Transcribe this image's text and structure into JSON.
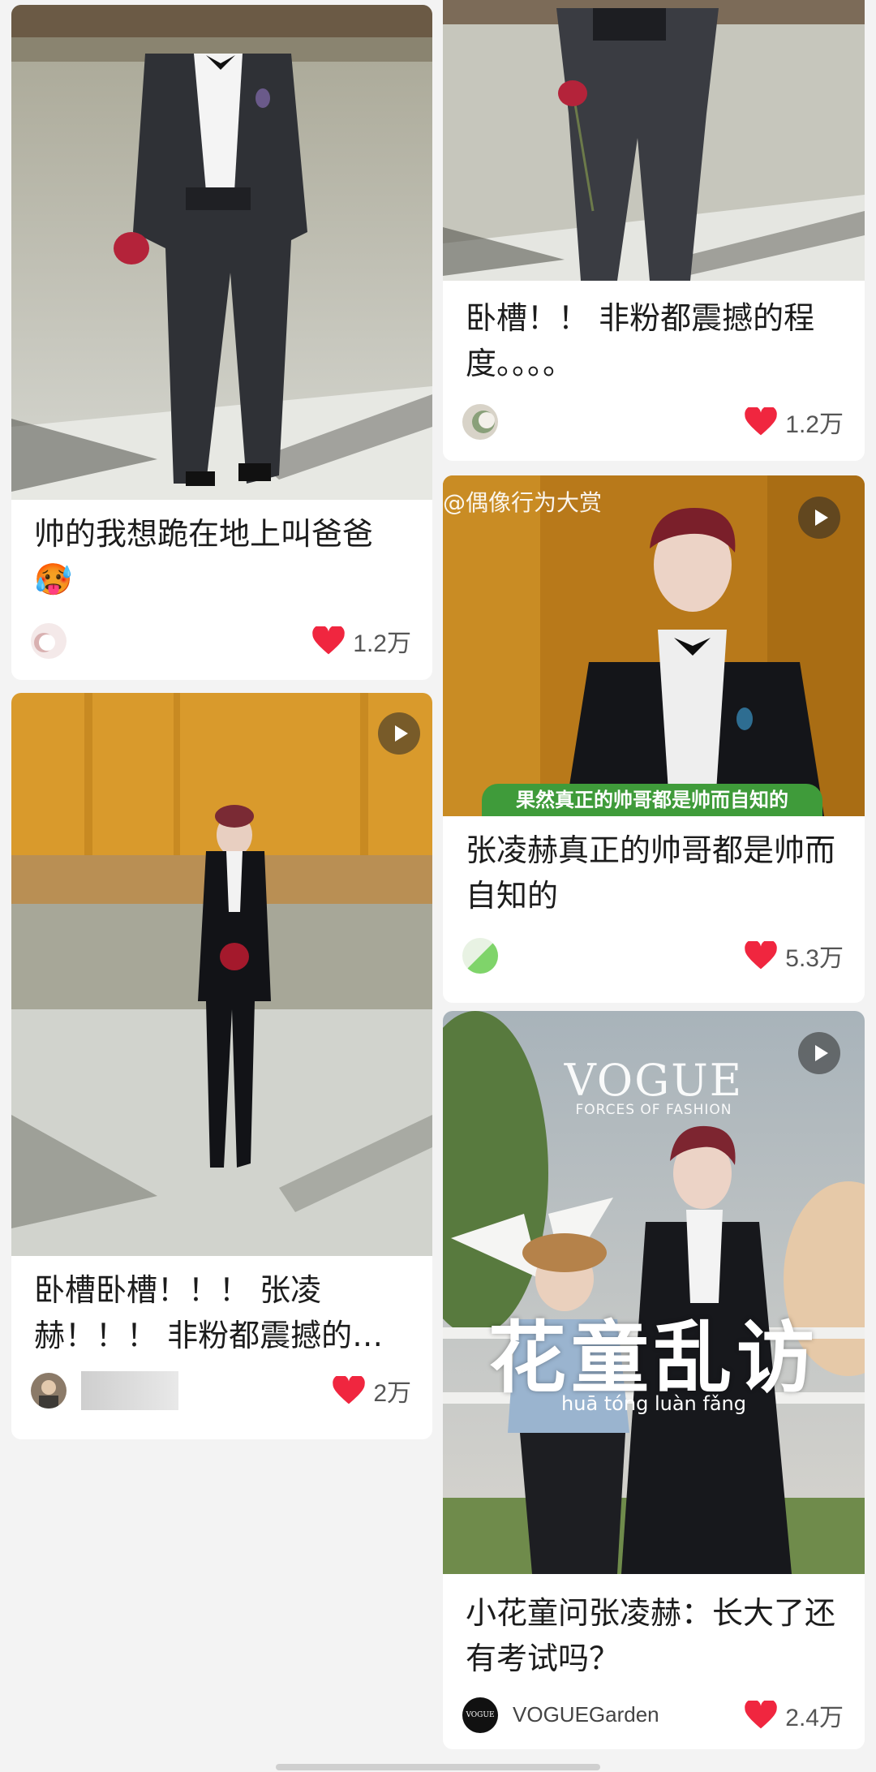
{
  "colors": {
    "heart": "#f0263f",
    "background": "#f3f3f3",
    "card": "#ffffff"
  },
  "posts": [
    {
      "title": "帅的我想跪在地上叫爸爸",
      "emoji": "🥵",
      "likes": "1.2万",
      "is_video": false
    },
    {
      "title": "卧槽卧槽！！！ 张凌赫！！！ 非粉都震撼的程…",
      "likes": "2万",
      "is_video": true
    },
    {
      "title": "卧槽！！ 非粉都震撼的程度。。。。",
      "likes": "1.2万",
      "is_video": false
    },
    {
      "title": "张凌赫真正的帅哥都是帅而自知的",
      "likes": "5.3万",
      "is_video": true,
      "watermark": "@偶像行为大赏",
      "caption": "果然真正的帅哥都是帅而自知的"
    },
    {
      "title": "小花童问张凌赫：长大了还有考试吗？",
      "likes": "2.4万",
      "is_video": true,
      "author": "VOGUEGarden",
      "avatar_text": "VOGUE",
      "logo": "VOGUE",
      "logo_sub": "FORCES OF FASHION",
      "overlay_title": "花童乱访",
      "overlay_pinyin": "huā tóng luàn fǎng"
    }
  ]
}
